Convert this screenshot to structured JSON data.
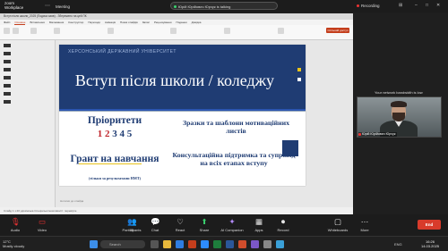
{
  "zoom": {
    "brand_line1": "zoom",
    "brand_line2": "Workplace",
    "meeting_label": "Meeting",
    "speaker_pill": "Юрій Юрійович Юрчук is talking",
    "recording_label": "Recording",
    "bandwidth_warning": "Your network bandwidth is low",
    "participant_name": "Юрій Юрійович Юрчук",
    "controls": {
      "audio": "Audio",
      "video": "Video",
      "participants": "Participants",
      "participants_count": "30",
      "chat": "Chat",
      "react": "React",
      "share": "Share",
      "ai_companion": "AI Companion",
      "apps": "Apps",
      "record": "Record",
      "whiteboards": "Whiteboards",
      "more": "More",
      "end": "End"
    }
  },
  "powerpoint": {
    "title_bar": "Вступ після школи_2025 (Подача заяв) - Збережено на цей ПК",
    "tabs": [
      "Файл",
      "Основне",
      "Вставлення",
      "Малювання",
      "Конструктор",
      "Переходи",
      "Анімація",
      "Показ слайдів",
      "Запис",
      "Рецензування",
      "Подання",
      "Довідка"
    ],
    "active_tab": "Основне",
    "share_button": "Спільний доступ",
    "notes_placeholder": "Нотатки до слайда",
    "status_bar": "Слайд 1 з 20   українська   Спеціальні можливості: перевірте"
  },
  "slide": {
    "university": "ХЕРСОНСЬКИЙ ДЕРЖАВНИЙ УНІВЕРСИТЕТ",
    "title": "Вступ після школи / коледжу",
    "priorities_label": "Пріоритети",
    "priority_numbers": [
      "1",
      "2",
      "3",
      "4",
      "5"
    ],
    "priority_colors": [
      "#c0262d",
      "#c0262d",
      "#1f3c73",
      "#1f3c73",
      "#1f3c73"
    ],
    "grant_label": "Грант на навчання",
    "grant_note": "(тільки за результатами НМТ)",
    "samples_text": "Зразки та шаблони мотиваційних листів",
    "consult_text": "Консультаційна підтримка та супровід на всіх етапах вступу",
    "colors": {
      "header": "#1f3c73",
      "accent_yellow": "#e8c21a"
    }
  },
  "taskbar": {
    "weather_temp": "12°C",
    "weather_desc": "Mostly cloudy",
    "search_placeholder": "Search",
    "time": "16:26",
    "date": "14.03.2025",
    "lang": "ENG"
  }
}
